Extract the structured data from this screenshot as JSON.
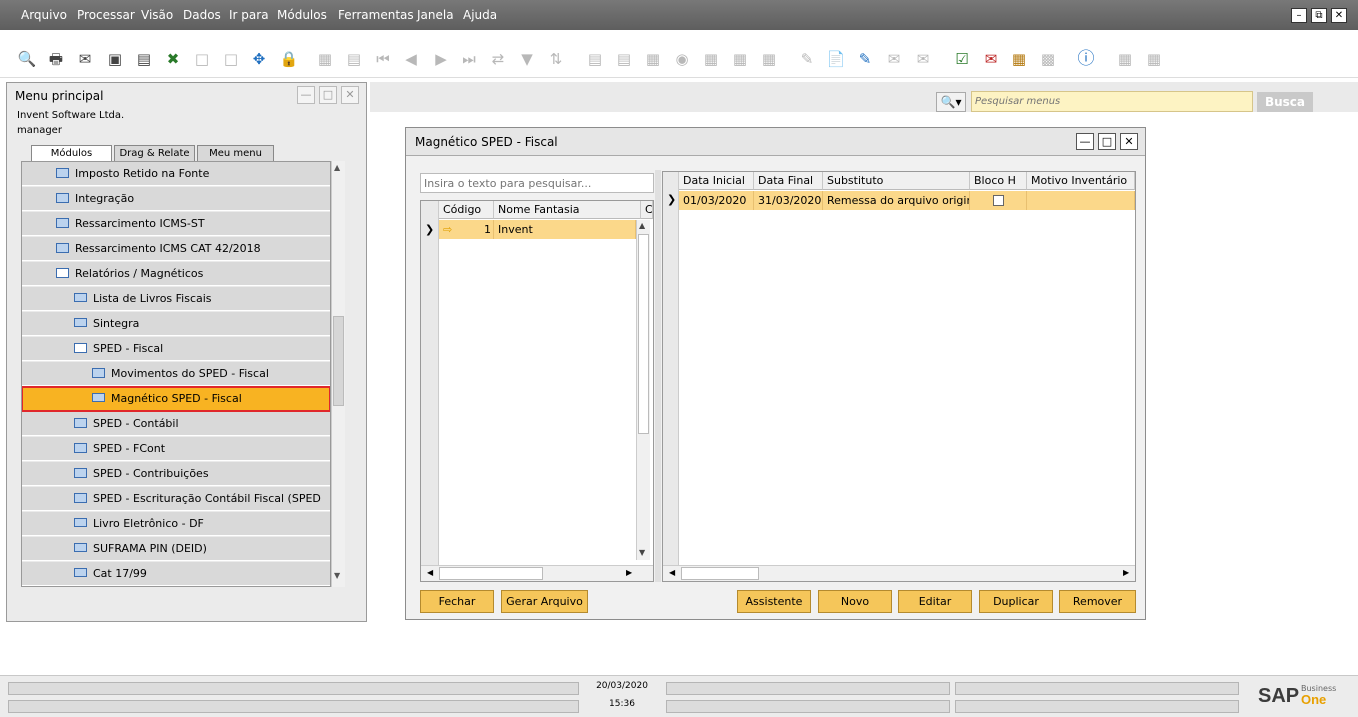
{
  "menu": {
    "items": [
      "Arquivo",
      "Processar",
      "Visão",
      "Dados",
      "Ir para",
      "Módulos",
      "Ferramentas",
      "Janela",
      "Ajuda"
    ],
    "window_controls": {
      "minimize": "–",
      "restore": "⧉",
      "close": "✕"
    }
  },
  "toolbar": {
    "icons": [
      "print-preview-icon",
      "print-icon",
      "email-icon",
      "export-icon",
      "fax-icon",
      "excel-icon",
      "word-icon",
      "pdf-icon",
      "launch-icon",
      "lock-icon",
      "find-icon",
      "form-settings-icon",
      "first-record-icon",
      "previous-record-icon",
      "next-record-icon",
      "last-record-icon",
      "refresh-icon",
      "filter-icon",
      "sort-icon",
      "base-document-icon",
      "target-document-icon",
      "gross-profit-icon",
      "payment-icon",
      "alert-icon",
      "cash-icon",
      "settlement-icon",
      "note-icon",
      "add-document-icon",
      "edit-document-icon",
      "message-icon",
      "reply-icon",
      "calendar-icon",
      "mail-alert-icon",
      "report-icon",
      "structure-icon",
      "help-icon",
      "settings-icon",
      "layout-icon"
    ]
  },
  "main_menu": {
    "title": "Menu principal",
    "company": "Invent Software Ltda.",
    "user": "manager",
    "tabs": [
      "Módulos",
      "Drag & Relate",
      "Meu menu"
    ],
    "active_tab": "Módulos",
    "items": [
      {
        "label": "Imposto Retido na Fonte",
        "type": "folder",
        "indent": 0
      },
      {
        "label": "Integração",
        "type": "folder",
        "indent": 0
      },
      {
        "label": "Ressarcimento ICMS-ST",
        "type": "folder",
        "indent": 0
      },
      {
        "label": "Ressarcimento ICMS CAT 42/2018",
        "type": "folder",
        "indent": 0
      },
      {
        "label": "Relatórios / Magnéticos",
        "type": "folder-open",
        "indent": 0
      },
      {
        "label": "Lista de Livros Fiscais",
        "type": "form",
        "indent": 1
      },
      {
        "label": "Sintegra",
        "type": "form",
        "indent": 1
      },
      {
        "label": "SPED - Fiscal",
        "type": "folder-open",
        "indent": 1
      },
      {
        "label": "Movimentos do SPED - Fiscal",
        "type": "folder",
        "indent": 2
      },
      {
        "label": "Magnético SPED - Fiscal",
        "type": "form",
        "indent": 2,
        "selected": true
      },
      {
        "label": "SPED - Contábil",
        "type": "folder",
        "indent": 1
      },
      {
        "label": "SPED - FCont",
        "type": "folder",
        "indent": 1
      },
      {
        "label": "SPED - Contribuições",
        "type": "folder",
        "indent": 1
      },
      {
        "label": "SPED - Escrituração Contábil Fiscal (SPED ECF)",
        "type": "folder",
        "indent": 1
      },
      {
        "label": "Livro Eletrônico - DF",
        "type": "form",
        "indent": 1
      },
      {
        "label": "SUFRAMA PIN (DEID)",
        "type": "form",
        "indent": 1
      },
      {
        "label": "Cat 17/99",
        "type": "form",
        "indent": 1
      }
    ]
  },
  "search": {
    "placeholder": "Pesquisar menus",
    "button": "Busca"
  },
  "window": {
    "title": "Magnético SPED - Fiscal",
    "left_search_placeholder": "Insira o texto para pesquisar...",
    "left_grid": {
      "columns": [
        "Código",
        "Nome Fantasia",
        "C"
      ],
      "rows": [
        {
          "codigo": "1",
          "nome": "Invent"
        }
      ]
    },
    "right_grid": {
      "columns": [
        "Data Inicial",
        "Data Final",
        "Substituto",
        "Bloco H",
        "Motivo Inventário"
      ],
      "rows": [
        {
          "data_inicial": "01/03/2020",
          "data_final": "31/03/2020",
          "substituto": "Remessa do arquivo original.",
          "bloco_h": false,
          "motivo": ""
        }
      ]
    },
    "buttons": {
      "fechar": "Fechar",
      "gerar": "Gerar Arquivo",
      "assistente": "Assistente",
      "novo": "Novo",
      "editar": "Editar",
      "duplicar": "Duplicar",
      "remover": "Remover"
    }
  },
  "status": {
    "date": "20/03/2020",
    "time": "15:36",
    "brand": "SAP",
    "brand_sub": "Business",
    "brand_one": "One"
  },
  "colors": {
    "selection": "#f8b322",
    "selection_border": "#e0272b",
    "button": "#f5c65a",
    "row_highlight": "#fbd88a"
  }
}
